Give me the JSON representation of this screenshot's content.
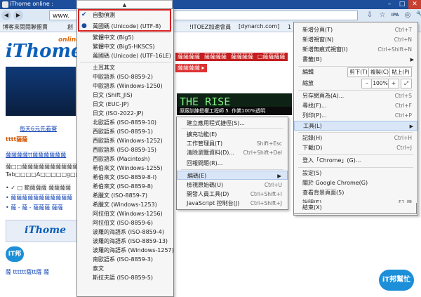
{
  "window": {
    "title": "iThome online : ",
    "controls": [
      "–",
      "□",
      "✕"
    ]
  },
  "toolbar": {
    "back": "◀",
    "forward": "▶",
    "url": "www.",
    "extensions": [
      "⇩",
      "☆",
      "IPA",
      "◎",
      "🔧"
    ]
  },
  "bookmarks": {
    "items": [
      "博客來閱閱聯盟賣",
      "創",
      "!ITOEZ加速會員",
      "[dynarch.com]",
      "1 其"
    ]
  },
  "page": {
    "logo": "iThome",
    "logo_sup": "online",
    "red_tabs": [
      "薩薩薩薩",
      "薩薩薩薩",
      "薩薩薩薩",
      "□薩薩薩薩",
      "薩薩薩薩"
    ],
    "red_tab_sub": "薩薩薩薩 ▸",
    "banner": "THE RISE",
    "banner_sub": "原廠訓練授權工程師 5. 作業100%透明",
    "city_link": "每天6元先看賽",
    "text_lines": [
      "tttt薩薩",
      "薩薩薩薩tt薩薩薩薩薩薩",
      "薩□□薩薩薩薩薩薩薩薩薩薩",
      "Tab□□□□A□□□□□g□□□@",
      "• ✓ □ 範薩薩薩 薩薩薩薩",
      "• 薩薩薩薩薩薩薩薩薩薩薩",
      "• 薩 - 薩 - 薩薩薩 薩薩"
    ],
    "ithome_box": "iThome",
    "it_bang": "IT邦",
    "it_bang_badge": "iT邦幫忙",
    "forum_line": "薩  tttttt薩tt薩 薩"
  },
  "encoding_menu": {
    "scroll_up": "▲",
    "items": [
      {
        "label": "自動偵測",
        "checked": true
      },
      {
        "label": "萬國碼 (Unicode) (UTF-8)",
        "selected": true
      },
      {
        "label": "繁體中文 (Big5)"
      },
      {
        "label": "繁體中文 (Big5-HKSCS)"
      },
      {
        "label": "萬國碼 (Unicode) (UTF-16LE)"
      },
      {
        "label": "土耳其文"
      },
      {
        "label": "中歐語系 (ISO-8859-2)"
      },
      {
        "label": "中歐語系 (Windows-1250)"
      },
      {
        "label": "日文 (Shift_JIS)"
      },
      {
        "label": "日文 (EUC-JP)"
      },
      {
        "label": "日文 (ISO-2022-JP)"
      },
      {
        "label": "北歐語系 (ISO-8859-10)"
      },
      {
        "label": "西歐語系 (ISO-8859-1)"
      },
      {
        "label": "西歐語系 (Windows-1252)"
      },
      {
        "label": "西歐語系 (ISO-8859-15)"
      },
      {
        "label": "西歐語系 (Macintosh)"
      },
      {
        "label": "希伯來文 (Windows-1255)"
      },
      {
        "label": "希伯來文 (ISO-8859-8-I)"
      },
      {
        "label": "希伯來文 (ISO-8859-8)"
      },
      {
        "label": "希臘文 (ISO-8859-7)"
      },
      {
        "label": "希臘文 (Windows-1253)"
      },
      {
        "label": "阿拉伯文 (Windows-1256)"
      },
      {
        "label": "阿拉伯文 (ISO-8859-6)"
      },
      {
        "label": "波羅的海語系 (ISO-8859-4)"
      },
      {
        "label": "波羅的海語系 (ISO-8859-13)"
      },
      {
        "label": "波羅的海語系 (Windows-1257)"
      },
      {
        "label": "南歐語系 (ISO-8859-3)"
      },
      {
        "label": "泰文"
      },
      {
        "label": "斯拉夫語 (ISO-8859-5)"
      }
    ]
  },
  "main_menu": {
    "new_tab": {
      "label": "新增分頁(T)",
      "shortcut": "Ctrl+T"
    },
    "new_window": {
      "label": "新增視窗(N)",
      "shortcut": "Ctrl+N"
    },
    "incognito": {
      "label": "新增無痕式視窗(I)",
      "shortcut": "Ctrl+Shift+N"
    },
    "bookmarks": {
      "label": "書籤(B)"
    },
    "edit": {
      "label": "編輯",
      "cut": "剪下(T)",
      "copy": "複製(C)",
      "paste": "貼上(P)"
    },
    "zoom": {
      "label": "縮放",
      "minus": "–",
      "value": "100%",
      "plus": "+",
      "full": "⤢"
    },
    "save_as": {
      "label": "另存網頁為(A)...",
      "shortcut": "Ctrl+S"
    },
    "find": {
      "label": "尋找(F)...",
      "shortcut": "Ctrl+F"
    },
    "print": {
      "label": "列印(P)...",
      "shortcut": "Ctrl+P"
    },
    "tools": {
      "label": "工具(L)"
    },
    "history": {
      "label": "記錄(H)",
      "shortcut": "Ctrl+H"
    },
    "downloads": {
      "label": "下載(D)",
      "shortcut": "Ctrl+J"
    },
    "signin": {
      "label": "登入「Chrome」(G)..."
    },
    "settings": {
      "label": "設定(S)"
    },
    "about": {
      "label": "關於 Google Chrome(G)"
    },
    "background": {
      "label": "查看背景頁面(5)"
    },
    "help": {
      "label": "說明(E)",
      "shortcut": "F1 鍵"
    },
    "exit": {
      "label": "結束(X)"
    }
  },
  "tools_menu": {
    "items": [
      {
        "label": "建立應用程式捷徑(S)..."
      },
      {
        "label": "擴充功能(E)"
      },
      {
        "label": "工作管理員(T)",
        "shortcut": "Shift+Esc"
      },
      {
        "label": "清除瀏覽資料(D)...",
        "shortcut": "Ctrl+Shift+Del"
      },
      {
        "label": "回報問題(R)..."
      },
      {
        "label": "編碼(E)",
        "highlighted": true
      },
      {
        "label": "檢視原始碼(U)",
        "shortcut": "Ctrl+U"
      },
      {
        "label": "開發人員工具(D)",
        "shortcut": "Ctrl+Shift+I"
      },
      {
        "label": "JavaScript 控制台(J)",
        "shortcut": "Ctrl+Shift+J"
      }
    ]
  }
}
